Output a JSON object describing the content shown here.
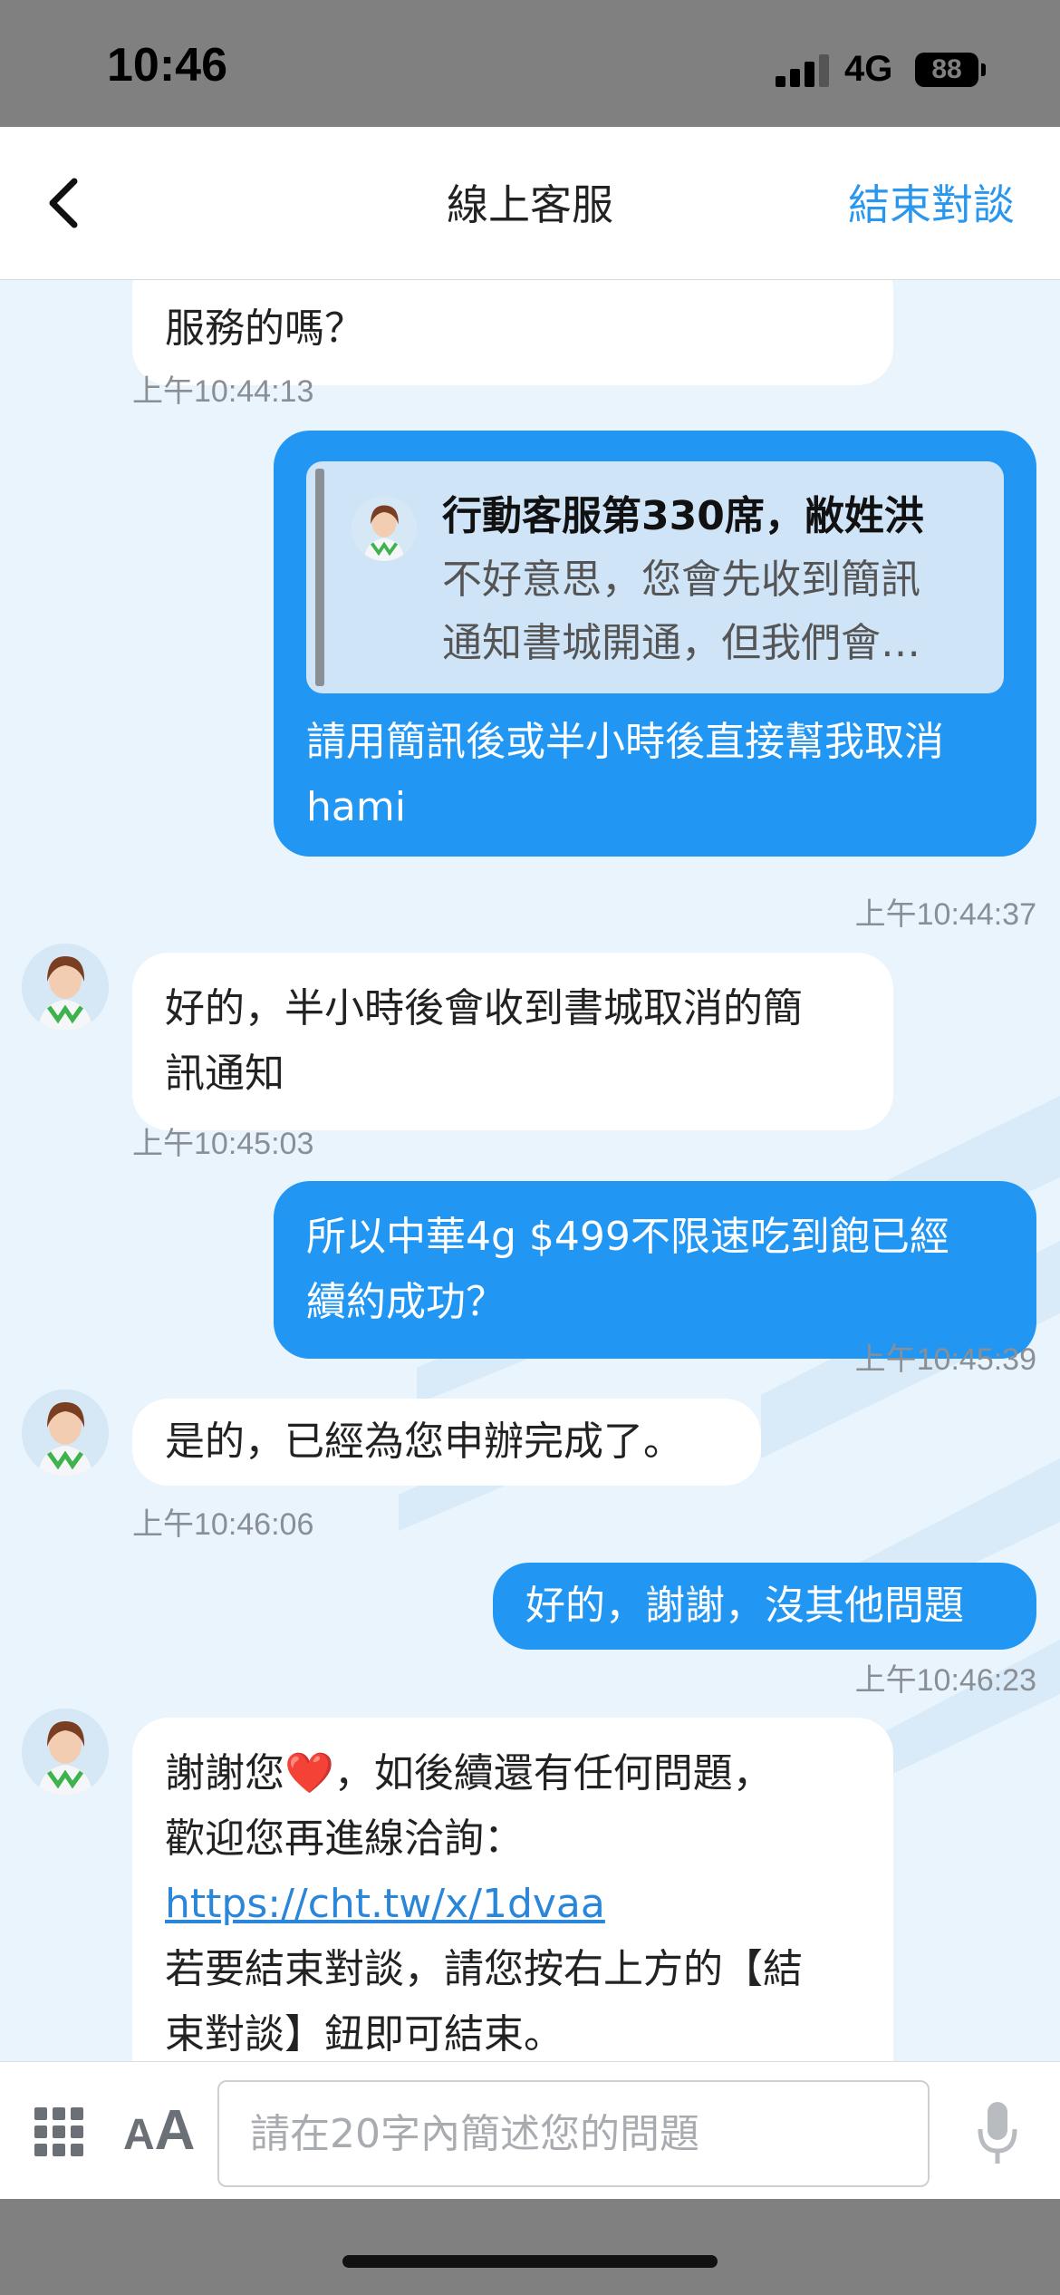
{
  "status_bar": {
    "time": "10:46",
    "network": "4G",
    "battery": "88"
  },
  "header": {
    "back_label": "‹",
    "title": "線上客服",
    "end_chat": "結束對談"
  },
  "messages": {
    "m1": {
      "text": "服務的嗎？",
      "time": "上午10:44:13"
    },
    "m2": {
      "quote_name": "行動客服第330席，敝姓洪",
      "quote_line1": "不好意思，您會先收到簡訊",
      "quote_line2": "通知書城開通，但我們會…",
      "text_line1": "請用簡訊後或半小時後直接幫我取消",
      "text_line2": "hami",
      "time": "上午10:44:37"
    },
    "m3": {
      "line1": "好的，半小時後會收到書城取消的簡",
      "line2": "訊通知",
      "time": "上午10:45:03"
    },
    "m4": {
      "line1": "所以中華4g $499不限速吃到飽已經",
      "line2": "續約成功？",
      "time": "上午10:45:39"
    },
    "m5": {
      "text": "是的，已經為您申辦完成了。",
      "time": "上午10:46:06"
    },
    "m6": {
      "text": "好的，謝謝，沒其他問題",
      "time": "上午10:46:23"
    },
    "m7": {
      "line1": "謝謝您❤️，如後續還有任何問題，",
      "line2": "歡迎您再進線洽詢：",
      "link": "https://cht.tw/x/1dvaa",
      "line3": "若要結束對談，請您按右上方的【結",
      "line4": "束對談】鈕即可結束。"
    }
  },
  "input": {
    "placeholder": "請在20字內簡述您的問題",
    "font_small": "A",
    "font_large": "A"
  },
  "colors": {
    "accent": "#2a97ee",
    "outgoing_bubble": "#2196f3",
    "chat_background": "#e9f4fc"
  }
}
